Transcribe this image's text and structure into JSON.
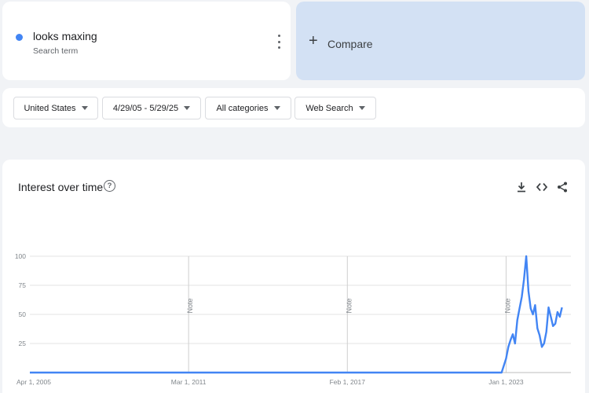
{
  "term": {
    "name": "looks maxing",
    "subtitle": "Search term",
    "color": "#4285f4"
  },
  "compare": {
    "plus": "+",
    "label": "Compare"
  },
  "filters": [
    "United States",
    "4/29/05 - 5/29/25",
    "All categories",
    "Web Search"
  ],
  "chart": {
    "title": "Interest over time",
    "help": "?",
    "note_label": "Note"
  },
  "chart_data": {
    "type": "line",
    "title": "Interest over time",
    "xlabel": "",
    "ylabel": "",
    "ylim": [
      0,
      100
    ],
    "yticks": [
      "25",
      "50",
      "75",
      "100"
    ],
    "xticks": [
      "Apr 1, 2005",
      "Mar 1, 2011",
      "Feb 1, 2017",
      "Jan 1, 2023"
    ],
    "notes": [
      "Note",
      "Note",
      "Note"
    ],
    "grid": true,
    "series": [
      {
        "name": "looks maxing",
        "color": "#4285f4",
        "points": [
          [
            "2005-04",
            0
          ],
          [
            "2022-11",
            0
          ],
          [
            "2023-01",
            12
          ],
          [
            "2023-02",
            22
          ],
          [
            "2023-03",
            28
          ],
          [
            "2023-04",
            33
          ],
          [
            "2023-05",
            25
          ],
          [
            "2023-06",
            45
          ],
          [
            "2023-07",
            55
          ],
          [
            "2023-08",
            65
          ],
          [
            "2023-09",
            80
          ],
          [
            "2023-10",
            100
          ],
          [
            "2023-11",
            70
          ],
          [
            "2023-12",
            55
          ],
          [
            "2024-01",
            50
          ],
          [
            "2024-02",
            58
          ],
          [
            "2024-03",
            38
          ],
          [
            "2024-04",
            32
          ],
          [
            "2024-05",
            22
          ],
          [
            "2024-06",
            25
          ],
          [
            "2024-07",
            35
          ],
          [
            "2024-08",
            56
          ],
          [
            "2024-09",
            48
          ],
          [
            "2024-10",
            40
          ],
          [
            "2024-11",
            42
          ],
          [
            "2024-12",
            52
          ],
          [
            "2025-01",
            48
          ],
          [
            "2025-02",
            56
          ]
        ]
      }
    ]
  }
}
